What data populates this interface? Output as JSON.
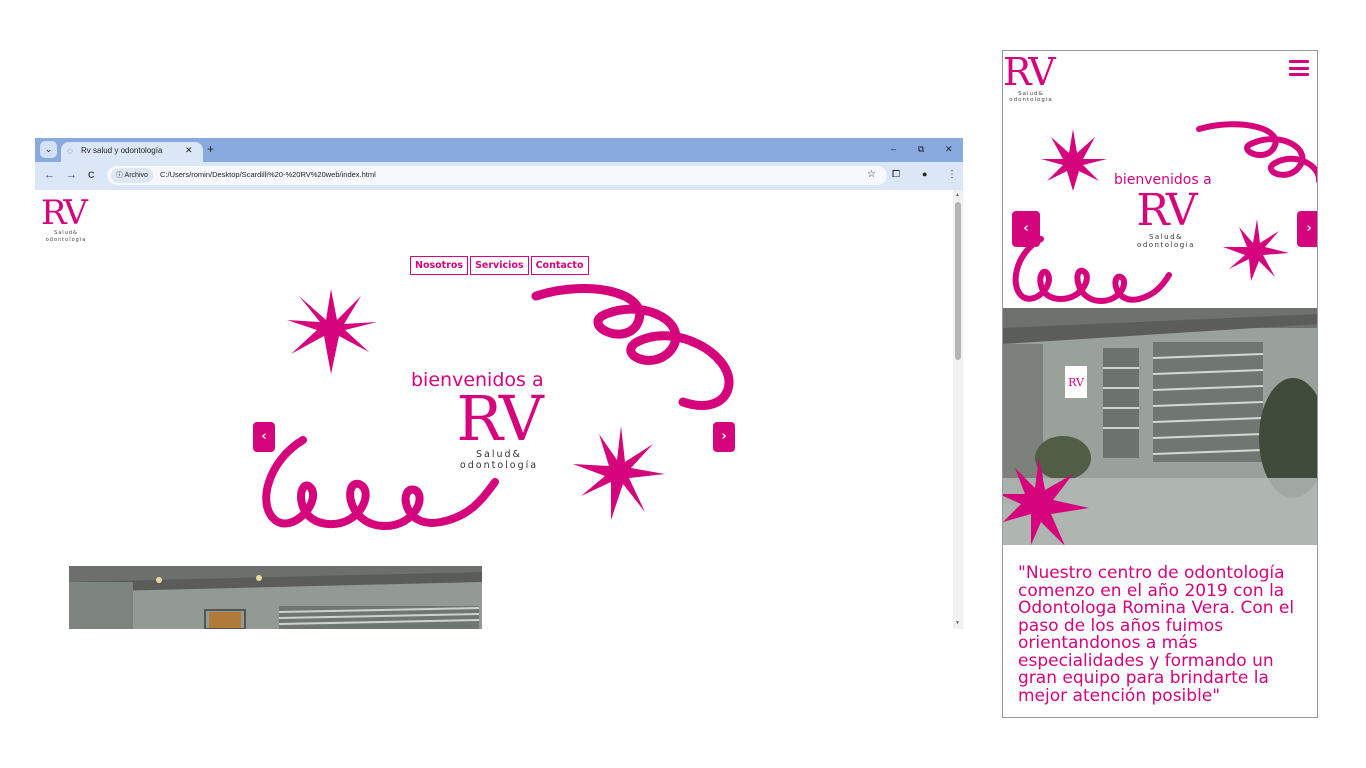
{
  "browser": {
    "tab_title": "Rv salud y odontología",
    "tab_close": "✕",
    "new_tab": "+",
    "tab_list_icon": "⌄",
    "window_controls": {
      "minimize": "–",
      "restore": "⧉",
      "close": "✕"
    },
    "nav": {
      "back": "←",
      "forward": "→",
      "reload": "C"
    },
    "omnibox": {
      "chip_label": "ⓘ Archivo",
      "url": "C:/Users/romin/Desktop/Scardilli%20-%20RV%20web/index.html"
    },
    "bookmark_icon": "☆",
    "toolbar_icons": {
      "extensions": "⧠",
      "profile": "●",
      "menu": "⋮"
    }
  },
  "site": {
    "logo": {
      "mark": "RV",
      "line1": "Salud&",
      "line2": "odontología"
    },
    "nav": [
      "Nosotros",
      "Servicios",
      "Contacto"
    ],
    "hero": {
      "title": "bienvenidos a",
      "logo": {
        "mark": "RV",
        "line1": "Salud&",
        "line2": "odontología"
      },
      "prev": "‹",
      "next": "›"
    }
  },
  "mobile": {
    "logo": {
      "mark": "RV",
      "line1": "Salud&",
      "line2": "odontologia"
    },
    "hero": {
      "title": "bienvenidos a",
      "logo": {
        "mark": "RV",
        "line1": "Salud&",
        "line2": "odontologia"
      },
      "prev": "‹",
      "next": "›"
    },
    "quote": "\"Nuestro centro de odontología comenzo en el año 2019 con la Odontologa Romina Vera. Con el paso de los años fuimos orientandonos a más especialidades y formando un gran equipo para brindarte la mejor atención posible\""
  },
  "colors": {
    "brand": "#d6047c",
    "chrome": "#88aadf",
    "toolbar": "#dbe6f6"
  },
  "icons": [
    "tab-list-icon",
    "favicon-icon",
    "close-icon",
    "plus-icon",
    "minimize-icon",
    "restore-icon",
    "back-arrow-icon",
    "forward-arrow-icon",
    "reload-icon",
    "info-icon",
    "star-icon",
    "extensions-icon",
    "profile-icon",
    "kebab-menu-icon",
    "hamburger-menu-icon",
    "starburst-icon",
    "squiggle-icon"
  ]
}
